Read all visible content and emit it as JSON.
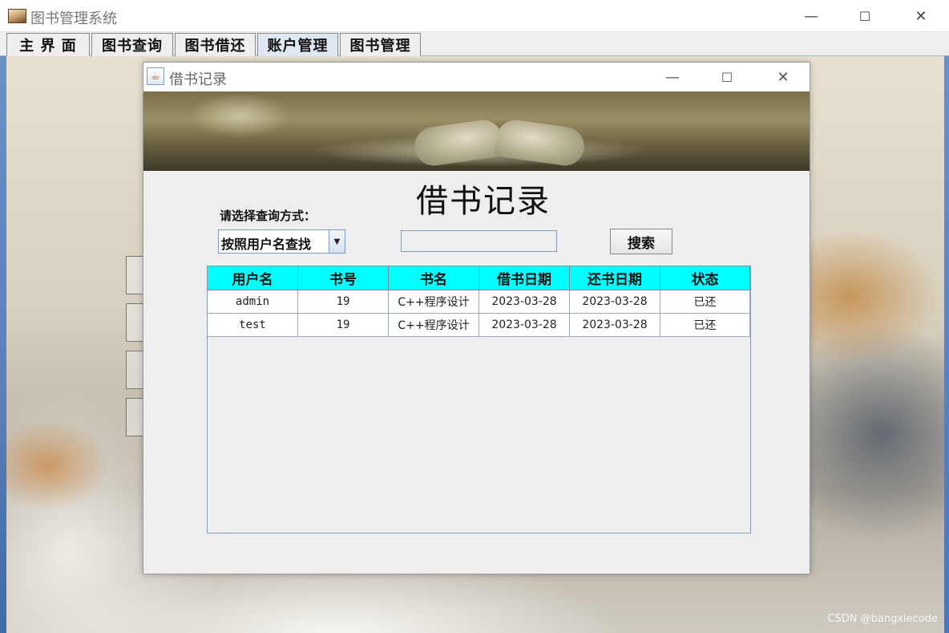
{
  "main_window": {
    "title": "图书管理系统",
    "controls": {
      "minimize": "—",
      "maximize": "☐",
      "close": "✕"
    }
  },
  "menu": {
    "tabs": [
      {
        "label": "主 界 面"
      },
      {
        "label": "图书查询"
      },
      {
        "label": "图书借还"
      },
      {
        "label": "账户管理",
        "active": true
      },
      {
        "label": "图书管理"
      }
    ]
  },
  "dialog": {
    "title": "借书记录",
    "controls": {
      "minimize": "—",
      "maximize": "☐",
      "close": "✕"
    },
    "heading": "借书记录",
    "query_label": "请选择查询方式：",
    "select": {
      "value": "按照用户名查找"
    },
    "search_input": {
      "value": ""
    },
    "search_button": "搜索",
    "table": {
      "headers": [
        "用户名",
        "书号",
        "书名",
        "借书日期",
        "还书日期",
        "状态"
      ],
      "rows": [
        [
          "admin",
          "19",
          "C++程序设计",
          "2023-03-28",
          "2023-03-28",
          "已还"
        ],
        [
          "test",
          "19",
          "C++程序设计",
          "2023-03-28",
          "2023-03-28",
          "已还"
        ]
      ]
    }
  },
  "watermark": "CSDN @bangxiecode",
  "colors": {
    "table_header_bg": "#00ffff"
  }
}
